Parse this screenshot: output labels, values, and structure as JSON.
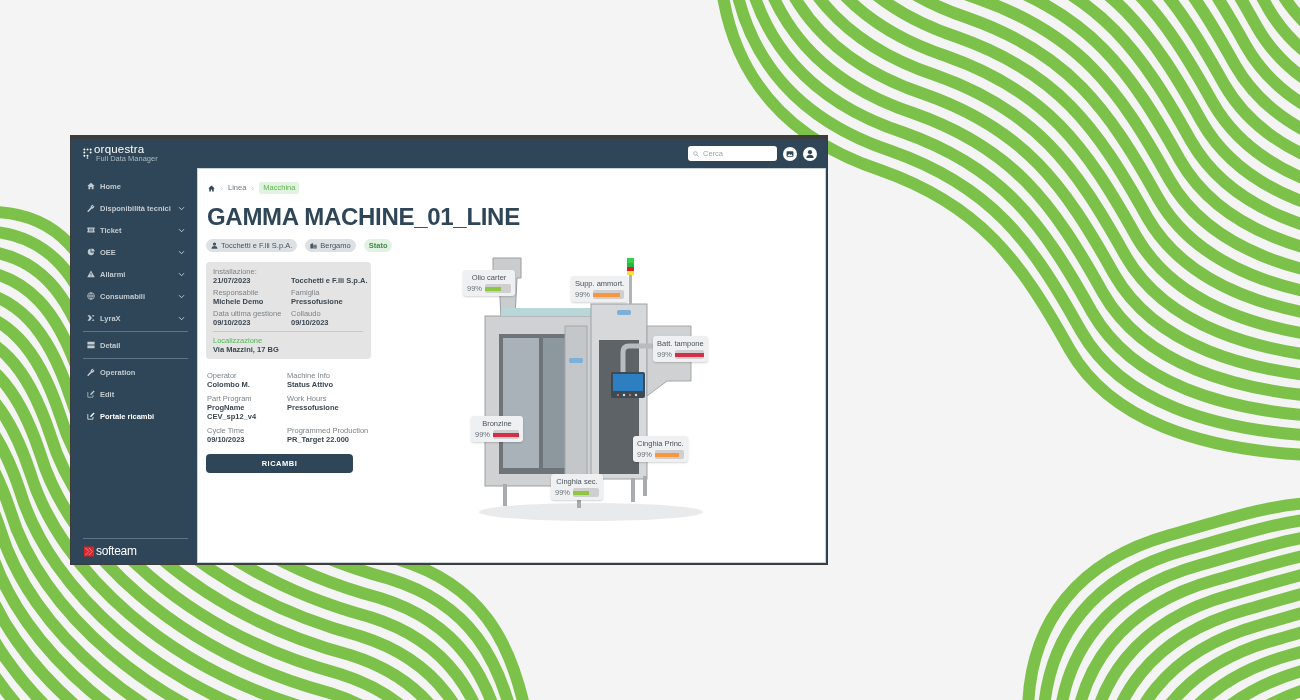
{
  "app": {
    "logo": {
      "name": "orquestra",
      "tagline": "Full Data Manager"
    },
    "search": {
      "placeholder": "Cerca"
    }
  },
  "sidebar": {
    "sections": [
      {
        "items": [
          {
            "label": "Home",
            "kind": "link",
            "selected": false
          },
          {
            "label": "Disponibilità tecnici",
            "kind": "group",
            "selected": false
          },
          {
            "label": "Ticket",
            "kind": "group",
            "selected": false
          },
          {
            "label": "OEE",
            "kind": "group",
            "selected": false
          },
          {
            "label": "Allarmi",
            "kind": "group",
            "selected": false
          },
          {
            "label": "Consumabili",
            "kind": "group",
            "selected": false
          },
          {
            "label": "LyraX",
            "kind": "group",
            "selected": false
          }
        ]
      },
      {
        "items": [
          {
            "label": "Detail",
            "kind": "link",
            "selected": false
          }
        ]
      },
      {
        "items": [
          {
            "label": "Operation",
            "kind": "link",
            "selected": false
          },
          {
            "label": "Edit",
            "kind": "link",
            "selected": false
          },
          {
            "label": "Portale ricambi",
            "kind": "link",
            "selected": true
          }
        ]
      }
    ],
    "footer_logo": "softeam"
  },
  "breadcrumb": [
    {
      "label": "Linea",
      "selected": false
    },
    {
      "label": "Macchina",
      "selected": true
    }
  ],
  "title": "GAMMA MACHINE_01_LINE",
  "chips": [
    {
      "label": "Tocchetti e F.lli S.p.A.",
      "kind": "company"
    },
    {
      "label": "Bergamo",
      "kind": "city"
    },
    {
      "label": "Stato",
      "kind": "status"
    }
  ],
  "info_card": {
    "fields": [
      {
        "label": "Installazione:",
        "value": "21/07/2023"
      },
      {
        "value": "Tocchetti e F.lli S.p.A."
      },
      {
        "label": "Responsabile",
        "value": "Michele Demo"
      },
      {
        "label": "Famiglia",
        "value": "Pressofusione"
      },
      {
        "label": "Data ultima gestione",
        "value": "09/10/2023"
      },
      {
        "label": "Collaudo",
        "value": "09/10/2023"
      }
    ],
    "location": {
      "label": "Localizzazione",
      "value": "Via Mazzini, 17 BG"
    }
  },
  "details": [
    {
      "label": "Operator",
      "value": "Colombo M."
    },
    {
      "label": "Machine Info",
      "value": "Status Attivo"
    },
    {
      "label": "Part Program",
      "value": "ProgName CEV_sp12_v4"
    },
    {
      "label": "Work Hours",
      "value": "Pressofusione"
    },
    {
      "label": "Cycle Time",
      "value": "09/10/2023"
    },
    {
      "label": "Programmed Production",
      "value": "PR_Target 22.000"
    }
  ],
  "button": "RICAMBI",
  "gauges": [
    {
      "label": "Olio carter",
      "reading": "99%",
      "level": 0.62,
      "color": "#8dc63f"
    },
    {
      "label": "Supp. ammort.",
      "reading": "99%",
      "level": 0.85,
      "color": "#f7963e"
    },
    {
      "label": "Batt. tampone",
      "reading": "99%",
      "level": 1,
      "color": "#d12f48"
    },
    {
      "label": "Bronzine",
      "reading": "99%",
      "level": 1,
      "color": "#d12f48"
    },
    {
      "label": "Cinghia Princ.",
      "reading": "99%",
      "level": 0.85,
      "color": "#f7963e"
    },
    {
      "label": "Cinghia sec.",
      "reading": "99%",
      "level": 0.6,
      "color": "#8dc63f"
    }
  ]
}
